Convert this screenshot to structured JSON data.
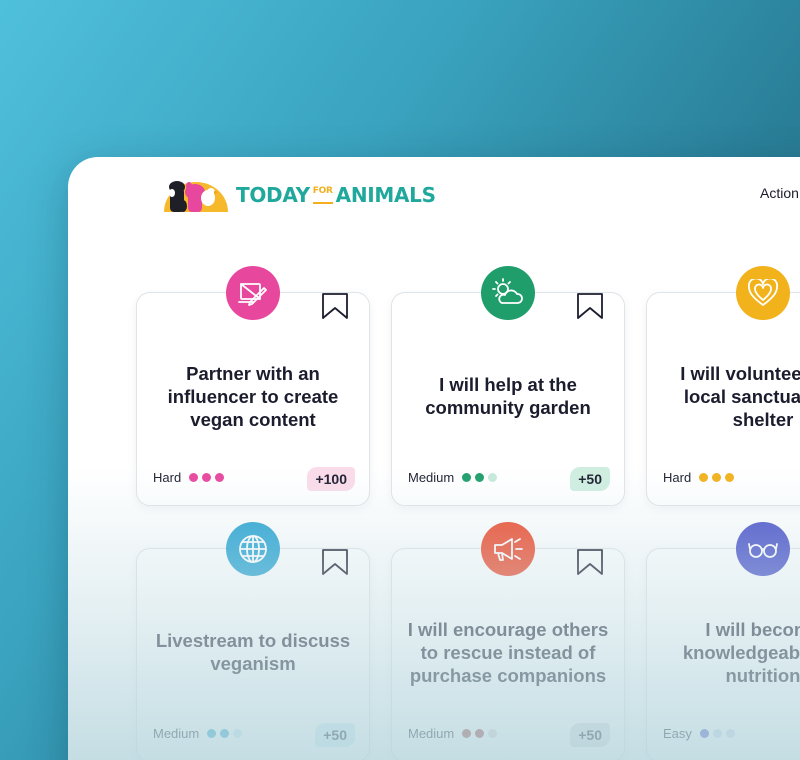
{
  "brand": {
    "name_part1": "TODAY",
    "name_for": "FOR",
    "name_part2": "ANIMALS",
    "color": "#20a89c",
    "accent": "#f2b01e"
  },
  "nav": {
    "actions_label": "Action"
  },
  "cards": [
    {
      "title": "Partner with an influencer to create vegan content",
      "difficulty": "Hard",
      "points": "+100",
      "icon": "laptop-pen-icon",
      "icon_color": "#e8479e",
      "dot_color": "#e8479e",
      "dot_fill": [
        1,
        1,
        1
      ],
      "points_bg": "#fbdbea"
    },
    {
      "title": "I will help at the community garden",
      "difficulty": "Medium",
      "points": "+50",
      "icon": "sun-cloud-icon",
      "icon_color": "#1f9e6b",
      "dot_color": "#1f9e6b",
      "dot_fill": [
        1,
        1,
        0
      ],
      "points_bg": "#cfeee0"
    },
    {
      "title": "I will volunteer at a local sanctuary or shelter",
      "difficulty": "Hard",
      "points": "",
      "icon": "heart-icon",
      "icon_color": "#f2b21b",
      "dot_color": "#f2b21b",
      "dot_fill": [
        1,
        1,
        1
      ],
      "points_bg": "#fdeec6"
    },
    {
      "title": "Livestream to discuss veganism",
      "difficulty": "Medium",
      "points": "+50",
      "icon": "globe-icon",
      "icon_color": "#27a3d1",
      "dot_color": "#27a3d1",
      "dot_fill": [
        1,
        1,
        0
      ],
      "points_bg": "#d2ecf6"
    },
    {
      "title": "I will encourage others to rescue instead of purchase companions",
      "difficulty": "Medium",
      "points": "+50",
      "icon": "megaphone-icon",
      "icon_color": "#ee4a2c",
      "dot_color": "#9a3a34",
      "dot_fill": [
        1,
        1,
        0
      ],
      "points_bg": "#d9dcde"
    },
    {
      "title": "I will become knowledgeable on nutrition",
      "difficulty": "Easy",
      "points": "",
      "icon": "glasses-icon",
      "icon_color": "#4a52c9",
      "dot_color": "#4a52c9",
      "dot_fill": [
        1,
        0,
        0
      ],
      "points_bg": "#d9dcf4"
    }
  ]
}
